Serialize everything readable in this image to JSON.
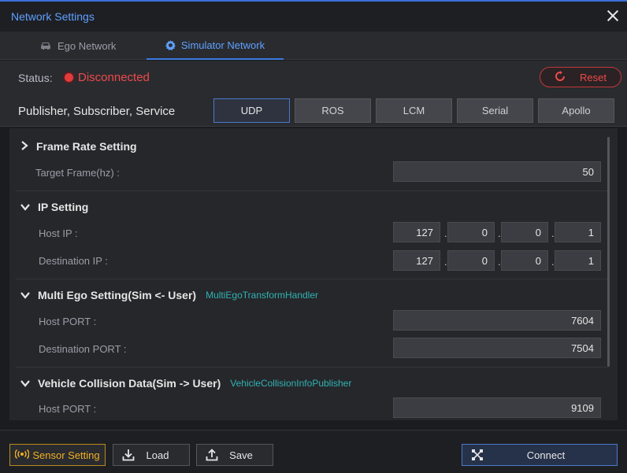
{
  "window": {
    "title": "Network Settings"
  },
  "tabs": [
    {
      "label": "Ego Network",
      "icon": "car-icon"
    },
    {
      "label": "Simulator Network",
      "icon": "gear-icon",
      "active": true
    }
  ],
  "status": {
    "label": "Status:",
    "value": "Disconnected",
    "color": "#ef4a4a"
  },
  "reset_label": "Reset",
  "protocol": {
    "label": "Publisher, Subscriber, Service",
    "options": [
      "UDP",
      "ROS",
      "LCM",
      "Serial",
      "Apollo"
    ],
    "selected": "UDP"
  },
  "sections": {
    "frame_rate": {
      "title": "Frame Rate Setting",
      "expanded": false,
      "target_label": "Target Frame(hz) :",
      "target_value": "50"
    },
    "ip": {
      "title": "IP Setting",
      "expanded": true,
      "host_label": "Host IP :",
      "host_ip": [
        "127",
        "0",
        "0",
        "1"
      ],
      "dest_label": "Destination IP :",
      "dest_ip": [
        "127",
        "0",
        "0",
        "1"
      ]
    },
    "multi_ego": {
      "title": "Multi Ego Setting(Sim <- User)",
      "handler": "MultiEgoTransformHandler",
      "host_port_label": "Host PORT :",
      "host_port": "7604",
      "dest_port_label": "Destination PORT :",
      "dest_port": "7504"
    },
    "collision": {
      "title": "Vehicle Collision Data(Sim -> User)",
      "handler": "VehicleCollisionInfoPublisher",
      "host_port_label": "Host PORT :",
      "host_port": "9109"
    }
  },
  "footer": {
    "sensor_label": "Sensor Setting",
    "load_label": "Load",
    "save_label": "Save",
    "connect_label": "Connect"
  },
  "colors": {
    "accent": "#3b7be0",
    "error": "#ef4a4a",
    "handler": "#2fb3b3",
    "sensor": "#f0b020"
  }
}
